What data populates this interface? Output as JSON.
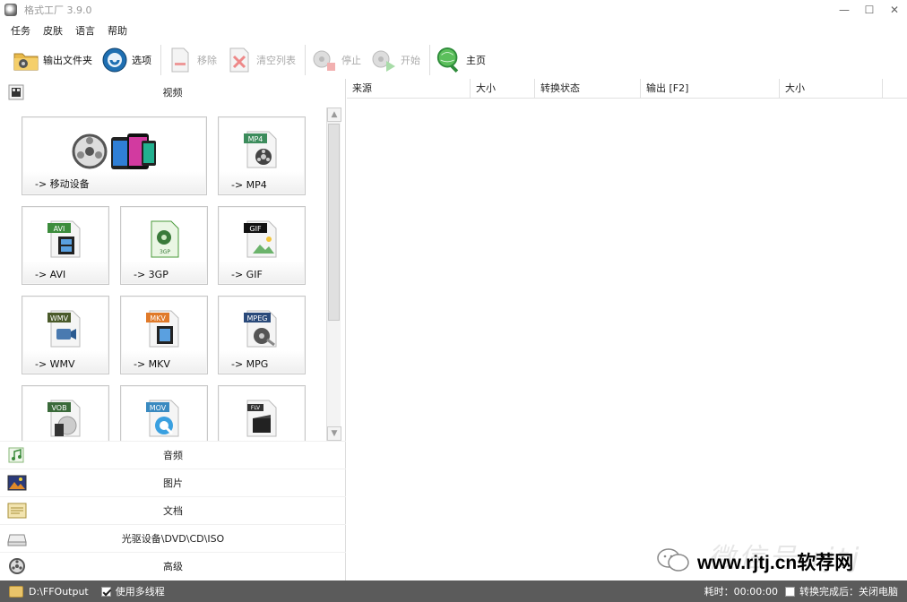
{
  "window": {
    "title": "格式工厂 3.9.0",
    "minimize": "—",
    "maximize": "☐",
    "close": "✕"
  },
  "menu": [
    "任务",
    "皮肤",
    "语言",
    "帮助"
  ],
  "toolbar": {
    "output_folder": "输出文件夹",
    "options": "选项",
    "remove": "移除",
    "clear_list": "清空列表",
    "stop": "停止",
    "start": "开始",
    "home": "主页"
  },
  "left": {
    "video_header": "视频",
    "tiles": [
      {
        "label": "-> 移动设备",
        "badge": ""
      },
      {
        "label": "-> MP4",
        "badge": "MP4"
      },
      {
        "label": "-> AVI",
        "badge": "AVI"
      },
      {
        "label": "-> 3GP",
        "badge": "3GP"
      },
      {
        "label": "-> GIF",
        "badge": "GIF"
      },
      {
        "label": "-> WMV",
        "badge": "WMV"
      },
      {
        "label": "-> MKV",
        "badge": "MKV"
      },
      {
        "label": "-> MPG",
        "badge": "MPEG"
      },
      {
        "label": "",
        "badge": "VOB"
      },
      {
        "label": "",
        "badge": "MOV"
      },
      {
        "label": "",
        "badge": "FLV"
      }
    ],
    "categories": [
      "音频",
      "图片",
      "文档",
      "光驱设备\\DVD\\CD\\ISO",
      "高级"
    ]
  },
  "table": {
    "columns": [
      "来源",
      "大小",
      "转换状态",
      "输出 [F2]",
      "大小"
    ]
  },
  "watermark": {
    "ghost": "微信号 rjtj",
    "text": "www.rjtj.cn软荐网"
  },
  "status": {
    "output_path": "D:\\FFOutput",
    "multithread": "使用多线程",
    "elapsed": "耗时：00:00:00",
    "after_done": "转换完成后：关闭电脑"
  },
  "colors": {
    "statusbar": "#5b5b5b",
    "accent_green": "#2e8b3a",
    "accent_blue": "#1f6fb2"
  }
}
